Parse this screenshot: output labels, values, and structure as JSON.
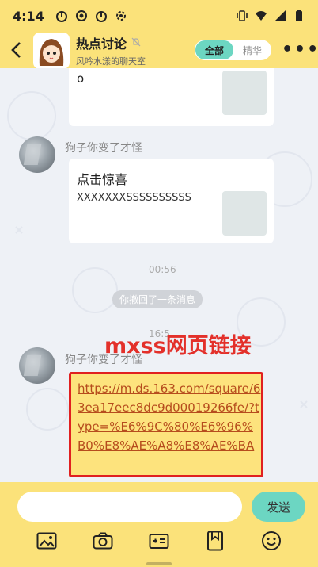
{
  "statusbar": {
    "time": "4:14"
  },
  "header": {
    "title": "热点讨论",
    "subtitle": "风吟水漾的聊天室",
    "tab_all": "全部",
    "tab_featured": "精华",
    "more": "•••"
  },
  "messages": [
    {
      "text": "o"
    },
    {
      "username": "狗子你变了才怪",
      "title": "点击惊喜",
      "body": "XXXXXXXSSSSSSSSSS"
    }
  ],
  "separator_time": "00:56",
  "recall_notice": "你撤回了一条消息",
  "partial_time": "16:5",
  "last_message": {
    "username": "狗子你变了才怪",
    "link": "https://m.ds.163.com/square/63ea17eec8dc9d00019266fe/?type=%E6%9C%80%E6%96%B0%E8%AE%A8%E8%AE%BA"
  },
  "overlay_caption": "mxss网页链接",
  "input": {
    "placeholder": "",
    "send_label": "发送"
  },
  "colors": {
    "theme_yellow": "#fbe27a",
    "accent_teal": "#6cd6c2",
    "annotation_red": "#e02020"
  }
}
